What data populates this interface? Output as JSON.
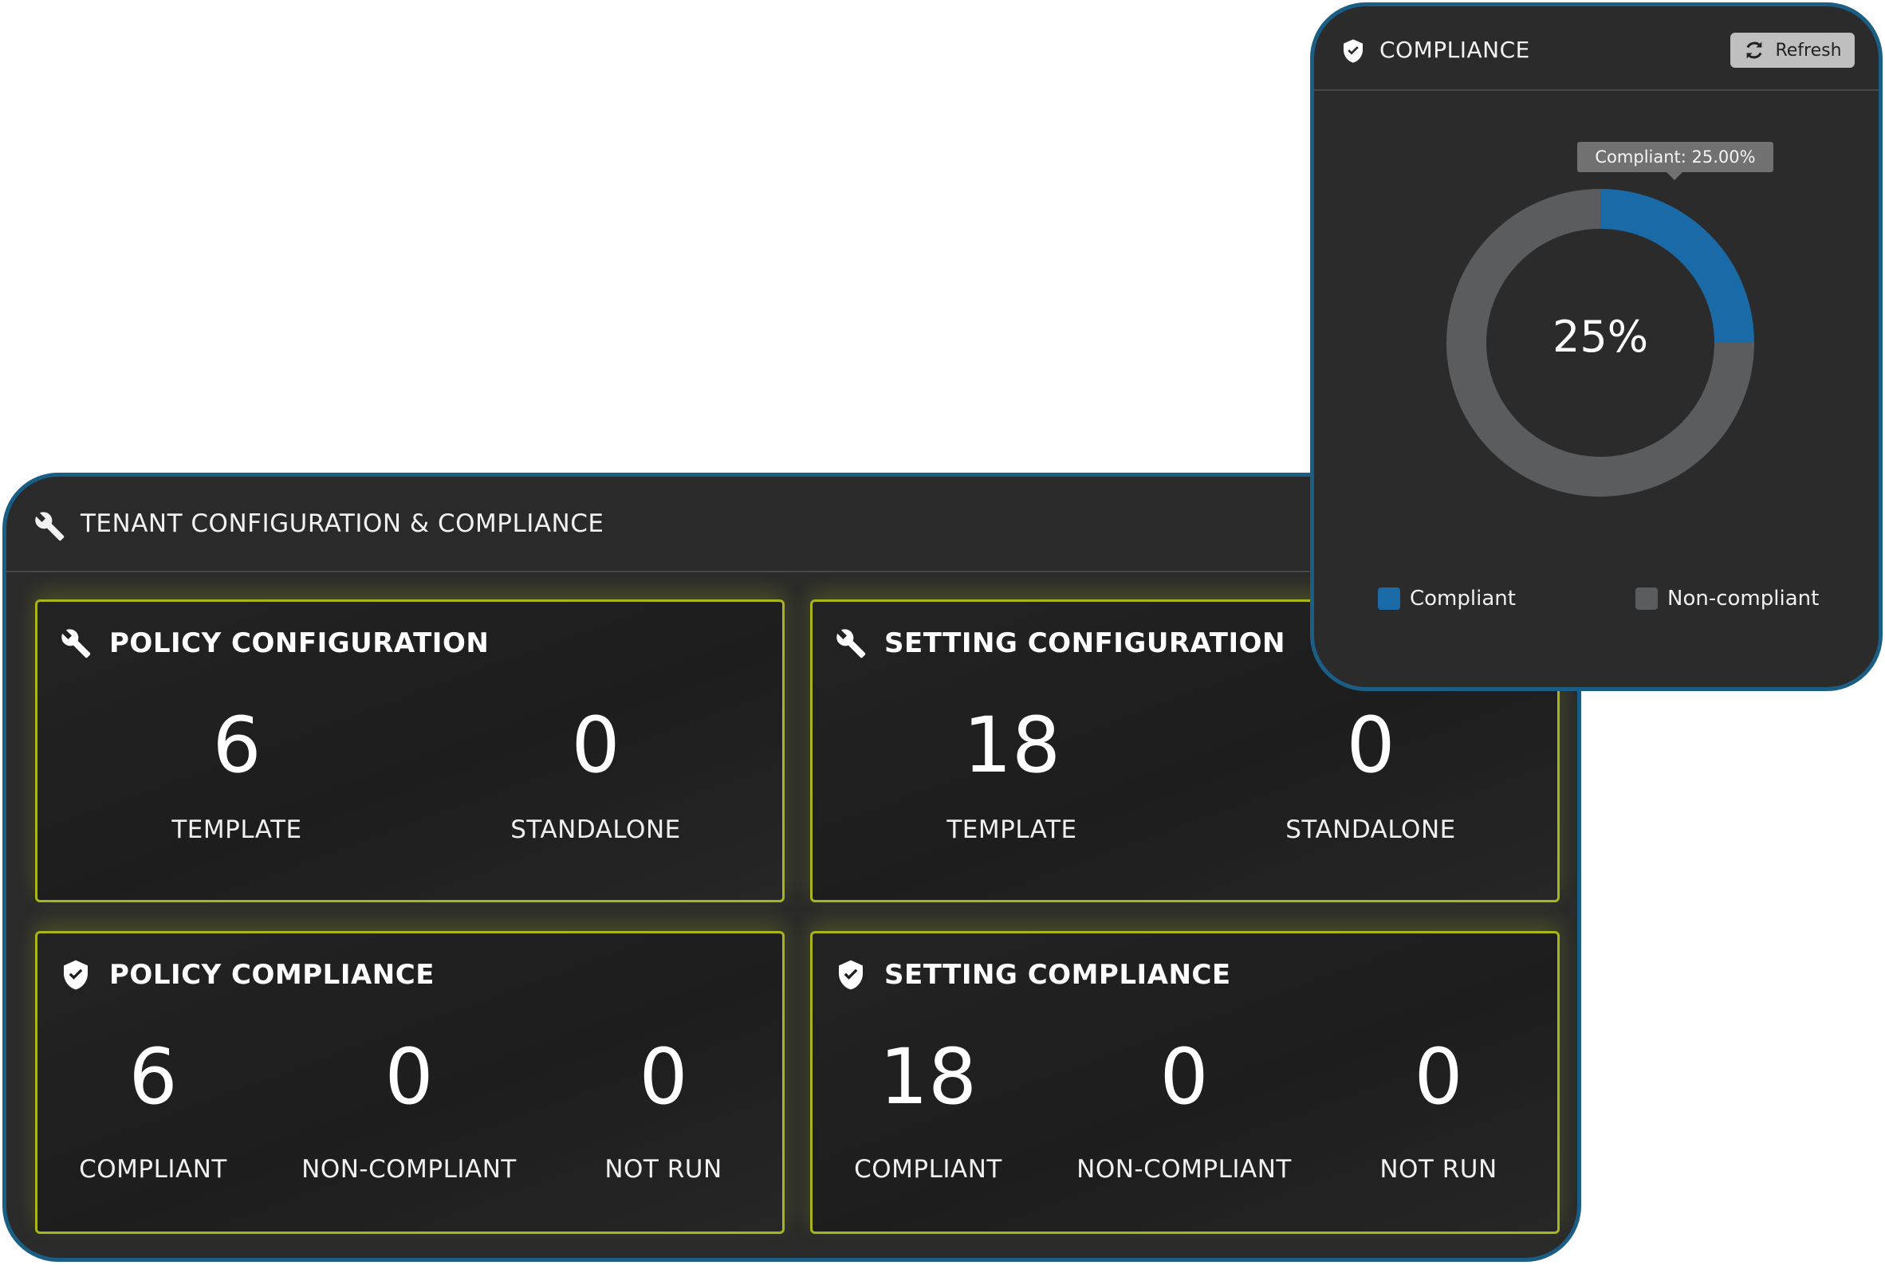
{
  "tenant_panel": {
    "title": "TENANT CONFIGURATION & COMPLIANCE",
    "cards": {
      "policy_configuration": {
        "title": "POLICY CONFIGURATION",
        "template_value": "6",
        "template_label": "TEMPLATE",
        "standalone_value": "0",
        "standalone_label": "STANDALONE"
      },
      "setting_configuration": {
        "title": "SETTING CONFIGURATION",
        "template_value": "18",
        "template_label": "TEMPLATE",
        "standalone_value": "0",
        "standalone_label": "STANDALONE"
      },
      "policy_compliance": {
        "title": "POLICY COMPLIANCE",
        "compliant_value": "6",
        "compliant_label": "COMPLIANT",
        "noncompliant_value": "0",
        "noncompliant_label": "NON-COMPLIANT",
        "notrun_value": "0",
        "notrun_label": "NOT RUN"
      },
      "setting_compliance": {
        "title": "SETTING COMPLIANCE",
        "compliant_value": "18",
        "compliant_label": "COMPLIANT",
        "noncompliant_value": "0",
        "noncompliant_label": "NON-COMPLIANT",
        "notrun_value": "0",
        "notrun_label": "NOT RUN"
      }
    }
  },
  "compliance_panel": {
    "title": "COMPLIANCE",
    "refresh_label": "Refresh",
    "tooltip": "Compliant: 25.00%",
    "center_label": "25%",
    "legend": [
      {
        "label": "Compliant",
        "color": "#1a6aa8"
      },
      {
        "label": "Non-compliant",
        "color": "#5b5c5e"
      }
    ]
  },
  "chart_data": {
    "type": "pie",
    "categories": [
      "Compliant",
      "Non-compliant"
    ],
    "values": [
      25,
      75
    ],
    "colors": [
      "#1a6aa8",
      "#5b5c5e"
    ],
    "legend": "bottom"
  },
  "icons": {
    "wrench": "wrench-icon",
    "shield": "shield-check-icon",
    "refresh": "refresh-icon"
  },
  "colors": {
    "card_border": "#a9b51a",
    "panel_border": "#1b5e85",
    "panel_bg": "#2a2a2a"
  }
}
